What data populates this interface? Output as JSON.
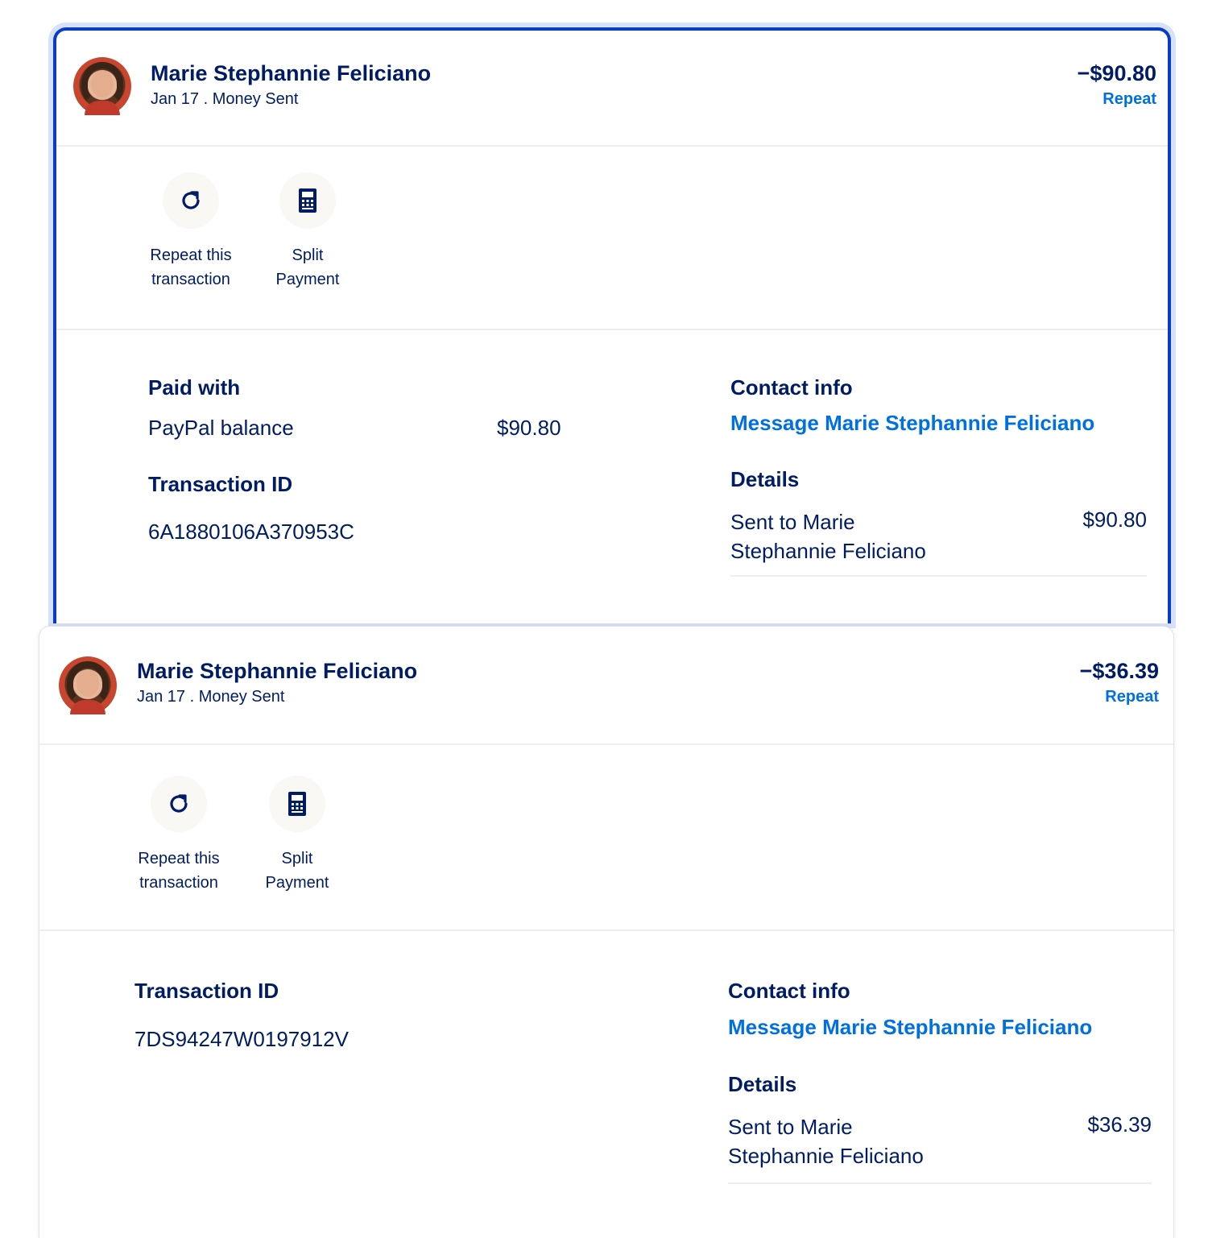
{
  "transactions": [
    {
      "name": "Marie Stephannie Feliciano",
      "subtitle": "Jan 17 . Money Sent",
      "amount": "−$90.80",
      "repeat_link": "Repeat",
      "actions": [
        {
          "label_line1": "Repeat this",
          "label_line2": "transaction",
          "icon": "repeat-icon"
        },
        {
          "label_line1": "Split",
          "label_line2": "Payment",
          "icon": "split-payment-icon"
        }
      ],
      "paid_with_heading": "Paid with",
      "paid_with_method": "PayPal balance",
      "paid_with_amount": "$90.80",
      "transaction_id_heading": "Transaction ID",
      "transaction_id": "6A1880106A370953C",
      "contact_heading": "Contact info",
      "contact_link": "Message Marie Stephannie Feliciano",
      "details_heading": "Details",
      "details_line1": "Sent to Marie",
      "details_line2": "Stephannie Feliciano",
      "details_amount": "$90.80"
    },
    {
      "name": "Marie Stephannie Feliciano",
      "subtitle": "Jan 17 . Money Sent",
      "amount": "−$36.39",
      "repeat_link": "Repeat",
      "actions": [
        {
          "label_line1": "Repeat this",
          "label_line2": "transaction",
          "icon": "repeat-icon"
        },
        {
          "label_line1": "Split",
          "label_line2": "Payment",
          "icon": "split-payment-icon"
        }
      ],
      "transaction_id_heading": "Transaction ID",
      "transaction_id": "7DS94247W0197912V",
      "contact_heading": "Contact info",
      "contact_link": "Message Marie Stephannie Feliciano",
      "details_heading": "Details",
      "details_line1": "Sent to Marie",
      "details_line2": "Stephannie Feliciano",
      "details_amount": "$36.39"
    }
  ],
  "colors": {
    "navy": "#001c64",
    "link_blue": "#0070e0",
    "selected_border": "#0a3bc4"
  }
}
